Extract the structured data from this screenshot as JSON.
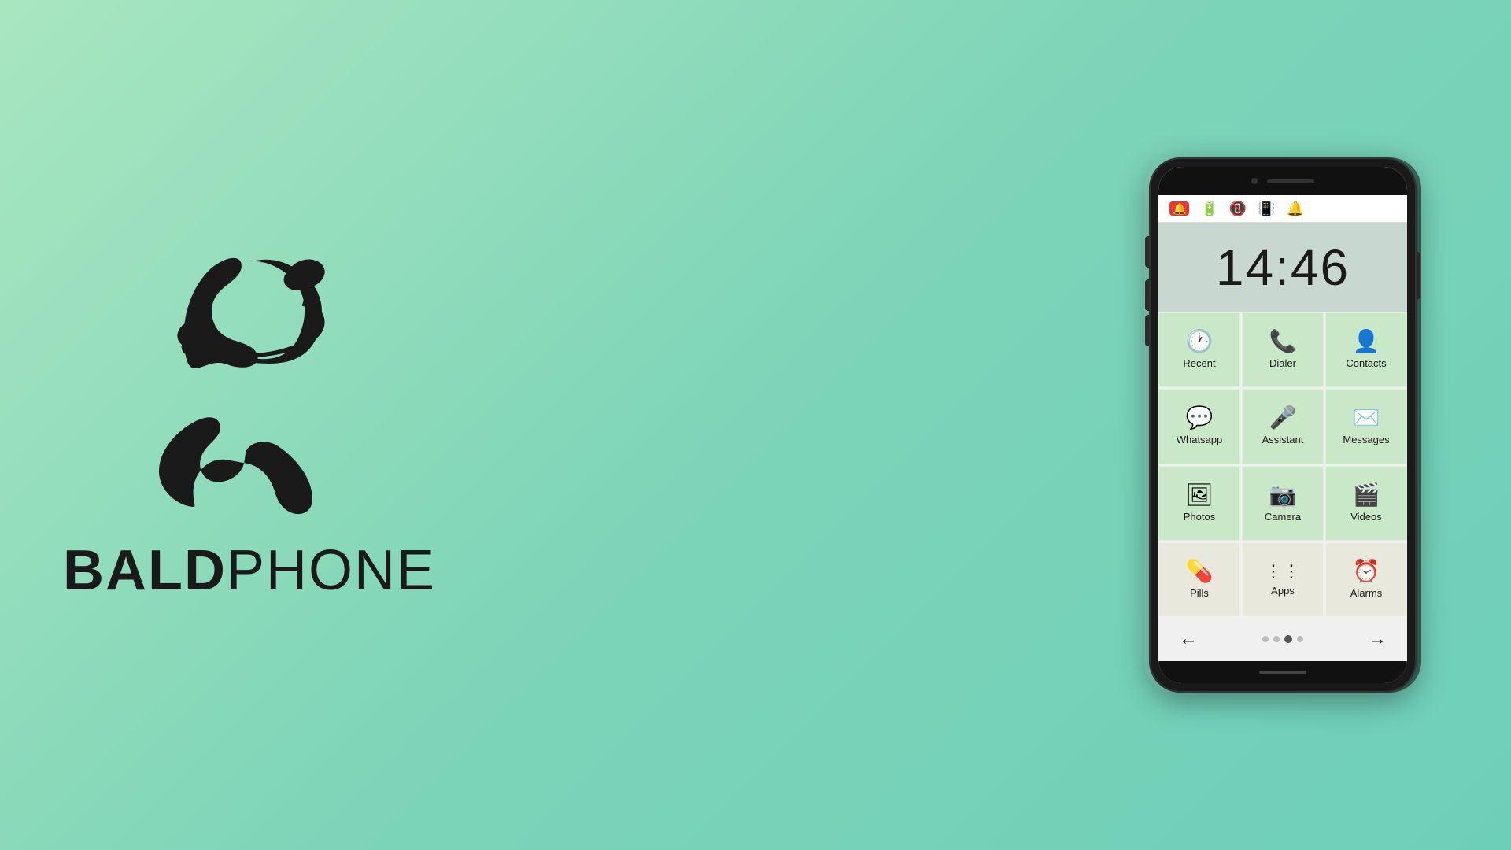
{
  "brand": {
    "bold": "BALD",
    "light": "PHONE"
  },
  "phone": {
    "time": "14:46",
    "status_icons": [
      "alert",
      "battery",
      "no-signal",
      "vibrate",
      "bell"
    ],
    "apps": [
      {
        "id": "recent",
        "label": "Recent",
        "icon": "🕐",
        "style": "green"
      },
      {
        "id": "dialer",
        "label": "Dialer",
        "icon": "📞",
        "style": "green"
      },
      {
        "id": "contacts",
        "label": "Contacts",
        "icon": "👤",
        "style": "green"
      },
      {
        "id": "whatsapp",
        "label": "Whatsapp",
        "icon": "💬",
        "style": "green"
      },
      {
        "id": "assistant",
        "label": "Assistant",
        "icon": "🎤",
        "style": "green"
      },
      {
        "id": "messages",
        "label": "Messages",
        "icon": "💬",
        "style": "green"
      },
      {
        "id": "photos",
        "label": "Photos",
        "icon": "🖼",
        "style": "green"
      },
      {
        "id": "camera",
        "label": "Camera",
        "icon": "📷",
        "style": "green"
      },
      {
        "id": "videos",
        "label": "Videos",
        "icon": "🎬",
        "style": "green"
      },
      {
        "id": "pills",
        "label": "Pills",
        "icon": "💊",
        "style": "light"
      },
      {
        "id": "apps",
        "label": "Apps",
        "icon": "⋮⋮",
        "style": "light"
      },
      {
        "id": "alarms",
        "label": "Alarms",
        "icon": "⏰",
        "style": "light"
      }
    ],
    "nav": {
      "back_arrow": "←",
      "forward_arrow": "→",
      "dots": [
        false,
        false,
        true,
        false
      ]
    }
  }
}
